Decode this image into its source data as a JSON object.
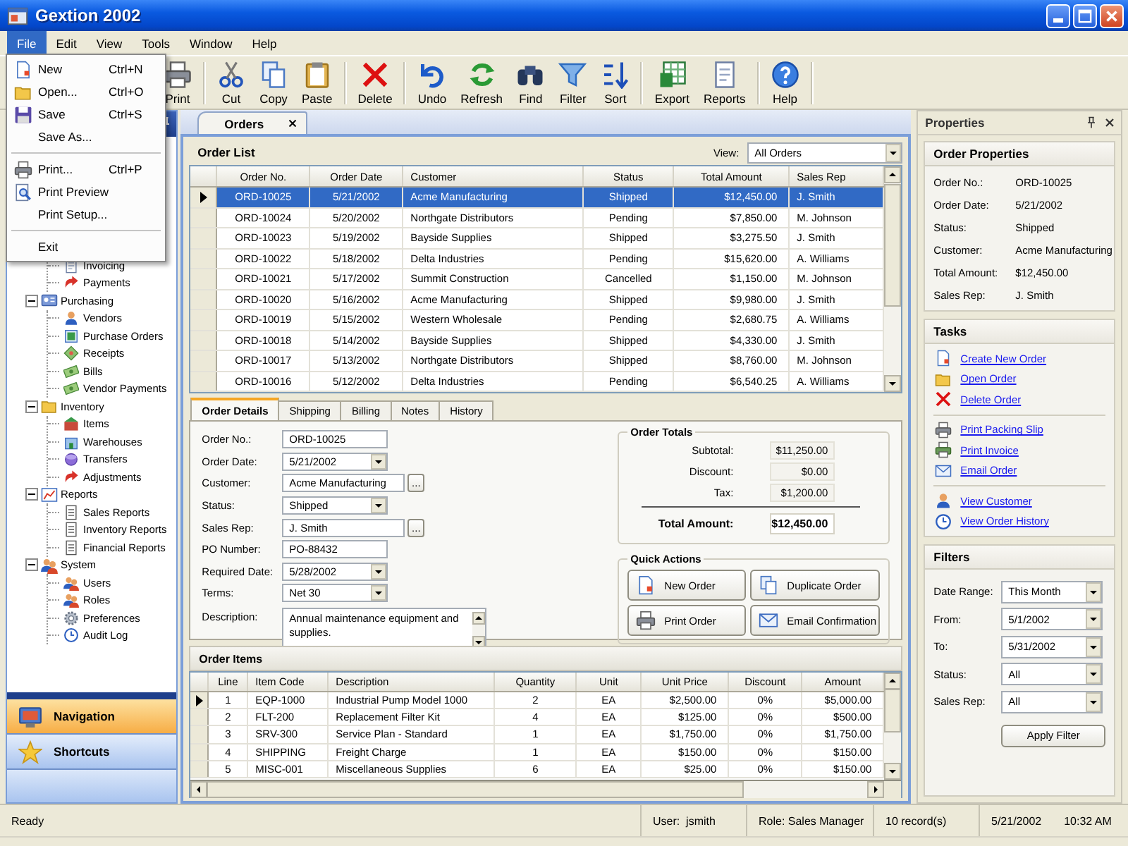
{
  "window": {
    "title": "Gextion 2002"
  },
  "menu_bar": [
    {
      "label": "File",
      "selected": true
    },
    {
      "label": "Edit",
      "selected": false
    },
    {
      "label": "View",
      "selected": false
    },
    {
      "label": "Tools",
      "selected": false
    },
    {
      "label": "Window",
      "selected": false
    },
    {
      "label": "Help",
      "selected": false
    }
  ],
  "file_menu": [
    {
      "kind": "item",
      "label": "New",
      "shortcut": "Ctrl+N"
    },
    {
      "kind": "item",
      "label": "Open...",
      "shortcut": "Ctrl+O"
    },
    {
      "kind": "item",
      "label": "Save",
      "shortcut": "Ctrl+S"
    },
    {
      "kind": "item",
      "label": "Save As..."
    },
    {
      "kind": "separator"
    },
    {
      "kind": "item",
      "label": "Print...",
      "shortcut": "Ctrl+P"
    },
    {
      "kind": "item",
      "label": "Print Preview"
    },
    {
      "kind": "item",
      "label": "Print Setup..."
    },
    {
      "kind": "separator"
    },
    {
      "kind": "item",
      "label": "Exit"
    }
  ],
  "toolbar": [
    {
      "kind": "button",
      "label": "Print"
    },
    {
      "kind": "separator"
    },
    {
      "kind": "button",
      "label": "Cut"
    },
    {
      "kind": "button",
      "label": "Copy"
    },
    {
      "kind": "button",
      "label": "Paste"
    },
    {
      "kind": "separator"
    },
    {
      "kind": "button",
      "label": "Delete"
    },
    {
      "kind": "separator"
    },
    {
      "kind": "button",
      "label": "Undo"
    },
    {
      "kind": "button",
      "label": "Refresh"
    },
    {
      "kind": "button",
      "label": "Find"
    },
    {
      "kind": "button",
      "label": "Filter"
    },
    {
      "kind": "button",
      "label": "Sort"
    },
    {
      "kind": "separator"
    },
    {
      "kind": "button",
      "label": "Export"
    },
    {
      "kind": "button",
      "label": "Reports"
    },
    {
      "kind": "separator"
    },
    {
      "kind": "button",
      "label": "Help"
    },
    {
      "kind": "separator"
    }
  ],
  "navigation": {
    "tree": [
      {
        "expanded": true,
        "children": [
          {
            "label": "Invoicing"
          },
          {
            "label": "Payments"
          }
        ]
      },
      {
        "label": "Purchasing",
        "expanded": true,
        "children": [
          {
            "label": "Vendors"
          },
          {
            "label": "Purchase Orders"
          },
          {
            "label": "Receipts"
          },
          {
            "label": "Bills"
          },
          {
            "label": "Vendor Payments"
          }
        ]
      },
      {
        "label": "Inventory",
        "expanded": true,
        "children": [
          {
            "label": "Items"
          },
          {
            "label": "Warehouses"
          },
          {
            "label": "Transfers"
          },
          {
            "label": "Adjustments"
          }
        ]
      },
      {
        "label": "Reports",
        "expanded": true,
        "children": [
          {
            "label": "Sales Reports"
          },
          {
            "label": "Inventory Reports"
          },
          {
            "label": "Financial Reports"
          }
        ]
      },
      {
        "label": "System",
        "expanded": true,
        "children": [
          {
            "label": "Users"
          },
          {
            "label": "Roles"
          },
          {
            "label": "Preferences"
          },
          {
            "label": "Audit Log"
          }
        ]
      }
    ],
    "panes": [
      {
        "label": "Navigation",
        "selected": true
      },
      {
        "label": "Shortcuts",
        "selected": false
      }
    ]
  },
  "document_tabs": [
    {
      "label": "Orders",
      "selected": true
    }
  ],
  "order_list": {
    "title": "Order List",
    "view_label": "View:",
    "view": "All Orders",
    "columns": [
      "Order No.",
      "Order Date",
      "Customer",
      "Status",
      "Total Amount",
      "Sales Rep"
    ],
    "rows": [
      {
        "selected": true,
        "cells": [
          "ORD-10025",
          "5/21/2002",
          "Acme Manufacturing",
          "Shipped",
          "$12,450.00",
          "J. Smith"
        ]
      },
      {
        "selected": false,
        "cells": [
          "ORD-10024",
          "5/20/2002",
          "Northgate Distributors",
          "Pending",
          "$7,850.00",
          "M. Johnson"
        ]
      },
      {
        "selected": false,
        "cells": [
          "ORD-10023",
          "5/19/2002",
          "Bayside Supplies",
          "Shipped",
          "$3,275.50",
          "J. Smith"
        ]
      },
      {
        "selected": false,
        "cells": [
          "ORD-10022",
          "5/18/2002",
          "Delta Industries",
          "Pending",
          "$15,620.00",
          "A. Williams"
        ]
      },
      {
        "selected": false,
        "cells": [
          "ORD-10021",
          "5/17/2002",
          "Summit Construction",
          "Cancelled",
          "$1,150.00",
          "M. Johnson"
        ]
      },
      {
        "selected": false,
        "cells": [
          "ORD-10020",
          "5/16/2002",
          "Acme Manufacturing",
          "Shipped",
          "$9,980.00",
          "J. Smith"
        ]
      },
      {
        "selected": false,
        "cells": [
          "ORD-10019",
          "5/15/2002",
          "Western Wholesale",
          "Pending",
          "$2,680.75",
          "A. Williams"
        ]
      },
      {
        "selected": false,
        "cells": [
          "ORD-10018",
          "5/14/2002",
          "Bayside Supplies",
          "Shipped",
          "$4,330.00",
          "J. Smith"
        ]
      },
      {
        "selected": false,
        "cells": [
          "ORD-10017",
          "5/13/2002",
          "Northgate Distributors",
          "Shipped",
          "$8,760.00",
          "M. Johnson"
        ]
      },
      {
        "selected": false,
        "cells": [
          "ORD-10016",
          "5/12/2002",
          "Delta Industries",
          "Pending",
          "$6,540.25",
          "A. Williams"
        ]
      }
    ]
  },
  "detail_tabs": [
    {
      "label": "Order Details",
      "selected": true
    },
    {
      "label": "Shipping",
      "selected": false
    },
    {
      "label": "Billing",
      "selected": false
    },
    {
      "label": "Notes",
      "selected": false
    },
    {
      "label": "History",
      "selected": false
    }
  ],
  "order_details": [
    {
      "kind": "text",
      "label": "Order No.:",
      "value": "ORD-10025"
    },
    {
      "kind": "dropdown",
      "label": "Order Date:",
      "value": "5/21/2002"
    },
    {
      "kind": "lookup",
      "label": "Customer:",
      "value": "Acme Manufacturing",
      "button": "..."
    },
    {
      "kind": "dropdown",
      "label": "Status:",
      "value": "Shipped"
    },
    {
      "kind": "lookup",
      "label": "Sales Rep:",
      "value": "J. Smith",
      "button": "..."
    },
    {
      "kind": "text",
      "label": "PO Number:",
      "value": "PO-88432"
    },
    {
      "kind": "dropdown",
      "label": "Required Date:",
      "value": "5/28/2002"
    },
    {
      "kind": "dropdown",
      "label": "Terms:",
      "value": "Net 30"
    },
    {
      "kind": "memo",
      "label": "Description:",
      "value": "Annual maintenance equipment and supplies."
    }
  ],
  "order_totals": {
    "title": "Order Totals",
    "rows": [
      {
        "label": "Subtotal:",
        "value": "$11,250.00"
      },
      {
        "label": "Discount:",
        "value": "$0.00"
      },
      {
        "label": "Tax:",
        "value": "$1,200.00"
      }
    ],
    "total": {
      "label": "Total Amount:",
      "value": "$12,450.00"
    }
  },
  "quick_actions": {
    "title": "Quick Actions",
    "buttons": [
      "New Order",
      "Duplicate Order",
      "Print Order",
      "Email Confirmation"
    ]
  },
  "order_items": {
    "title": "Order Items",
    "columns": [
      "Line",
      "Item Code",
      "Description",
      "Quantity",
      "Unit",
      "Unit Price",
      "Discount",
      "Amount"
    ],
    "rows": [
      {
        "current": true,
        "cells": [
          "1",
          "EQP-1000",
          "Industrial Pump Model 1000",
          "2",
          "EA",
          "$2,500.00",
          "0%",
          "$5,000.00"
        ]
      },
      {
        "current": false,
        "cells": [
          "2",
          "FLT-200",
          "Replacement Filter Kit",
          "4",
          "EA",
          "$125.00",
          "0%",
          "$500.00"
        ]
      },
      {
        "current": false,
        "cells": [
          "3",
          "SRV-300",
          "Service Plan - Standard",
          "1",
          "EA",
          "$1,750.00",
          "0%",
          "$1,750.00"
        ]
      },
      {
        "current": false,
        "cells": [
          "4",
          "SHIPPING",
          "Freight Charge",
          "1",
          "EA",
          "$150.00",
          "0%",
          "$150.00"
        ]
      },
      {
        "current": false,
        "cells": [
          "5",
          "MISC-001",
          "Miscellaneous Supplies",
          "6",
          "EA",
          "$25.00",
          "0%",
          "$150.00"
        ]
      }
    ]
  },
  "properties": {
    "title": "Properties",
    "order_properties": {
      "title": "Order Properties",
      "rows": [
        {
          "label": "Order No.:",
          "value": "ORD-10025"
        },
        {
          "label": "Order Date:",
          "value": "5/21/2002"
        },
        {
          "label": "Status:",
          "value": "Shipped"
        },
        {
          "label": "Customer:",
          "value": "Acme Manufacturing"
        },
        {
          "label": "Total Amount:",
          "value": "$12,450.00"
        },
        {
          "label": "Sales Rep:",
          "value": "J. Smith"
        }
      ]
    },
    "tasks": {
      "title": "Tasks",
      "groups": [
        {
          "links": [
            "Create New Order",
            "Open Order",
            "Delete Order"
          ]
        },
        {
          "links": [
            "Print Packing Slip",
            "Print Invoice",
            "Email Order"
          ]
        },
        {
          "links": [
            "View Customer",
            "View Order History"
          ]
        }
      ]
    },
    "filters": {
      "title": "Filters",
      "fields": [
        {
          "label": "Date Range:",
          "value": "This Month"
        },
        {
          "label": "From:",
          "value": "5/1/2002"
        },
        {
          "label": "To:",
          "value": "5/31/2002"
        },
        {
          "label": "Status:",
          "value": "All"
        },
        {
          "label": "Sales Rep:",
          "value": "All"
        }
      ],
      "button": "Apply Filter"
    }
  },
  "status_bar": {
    "message": "Ready",
    "user": "User:  jsmith",
    "role": "Role: Sales Manager",
    "records": "10 record(s)",
    "date": "5/21/2002",
    "time": "10:32 AM"
  }
}
